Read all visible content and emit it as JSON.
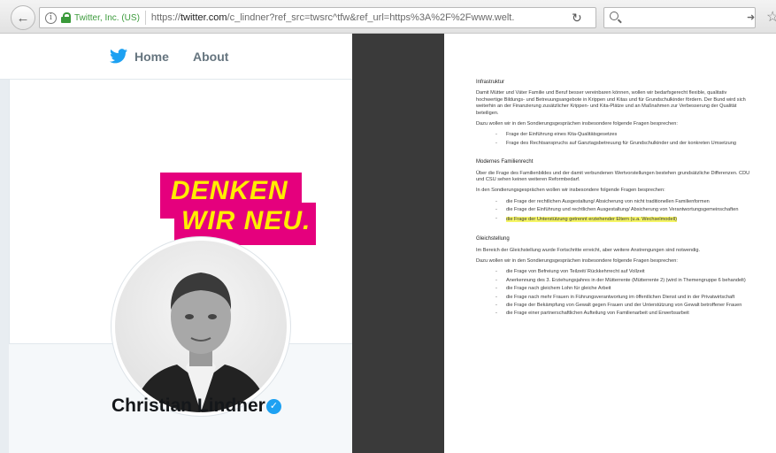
{
  "browser": {
    "identity": "Twitter, Inc. (US)",
    "url_prefix": "https://",
    "url_domain": "twitter.com",
    "url_rest": "/c_lindner?ref_src=twsrc^tfw&ref_url=https%3A%2F%2Fwww.welt."
  },
  "twitter": {
    "nav_home": "Home",
    "nav_about": "About",
    "banner_line1": "DENKEN",
    "banner_line2": "WIR NEU.",
    "display_name": "Christian Lindner",
    "colors": {
      "brand_blue": "#1da1f2",
      "banner_magenta": "#e5007d",
      "banner_yellow": "#ffed00"
    }
  },
  "document": {
    "s1_title": "Infrastruktur",
    "s1_p1": "Damit Mütter und Väter Familie und Beruf besser vereinbaren können, wollen wir bedarfsgerecht flexible, qualitativ hochwertige Bildungs- und Betreuungsangebote in Krippen und Kitas und für Grundschulkinder fördern. Der Bund wird sich weiterhin an der Finanzierung zusätzlicher Krippen- und Kita-Plätze und an Maßnahmen zur Verbesserung der Qualität beteiligen.",
    "s1_p2": "Dazu wollen wir in den Sondierungsgesprächen insbesondere folgende Fragen besprechen:",
    "s1_items": [
      "Frage der Einführung eines Kita-Qualitätsgesetzes",
      "Frage des Rechtsanspruchs auf Ganztagsbetreuung für Grundschulkinder und der konkreten Umsetzung"
    ],
    "s2_title": "Modernes Familienrecht",
    "s2_p1": "Über die Frage des Familienbildes und der damit verbundenen Wertvorstellungen bestehen grundsätzliche Differenzen. CDU und CSU sehen keinen weiteren Reformbedarf.",
    "s2_p2": "In den Sondierungsgesprächen wollen wir insbesondere folgende Fragen besprechen:",
    "s2_items": [
      "die Frage der rechtlichen Ausgestaltung/ Absicherung von nicht traditionellen Familienformen",
      "die Frage der Einführung und rechtlichen Ausgestaltung/ Absicherung von Verantwortungsgemeinschaften"
    ],
    "s2_highlight": "die Frage der Unterstützung getrennt erziehender Eltern (u.a. Wechselmodell)",
    "s3_title": "Gleichstellung",
    "s3_p1": "Im Bereich der Gleichstellung wurde Fortschritte erreicht, aber weitere Anstrengungen sind notwendig.",
    "s3_p2": "Dazu wollen wir in den Sondierungsgesprächen insbesondere folgende Fragen besprechen:",
    "s3_items": [
      "die Frage von Befreiung von Teilzeit/ Rückkehrrecht auf Vollzeit",
      "Anerkennung des 3. Erziehungsjahres in der Mütterrente (Mütterrente 2) (wird in Themengruppe 6 behandelt)",
      "die Frage nach gleichem Lohn für gleiche Arbeit",
      "die Frage nach mehr Frauen in Führungsverantwortung im öffentlichen Dienst und in der Privatwirtschaft",
      "die Frage der Bekämpfung von Gewalt gegen Frauen und der Unterstützung von Gewalt betroffener Frauen",
      "die Frage einer partnerschaftlichen Aufteilung von Familienarbeit und Erwerbsarbeit"
    ]
  }
}
